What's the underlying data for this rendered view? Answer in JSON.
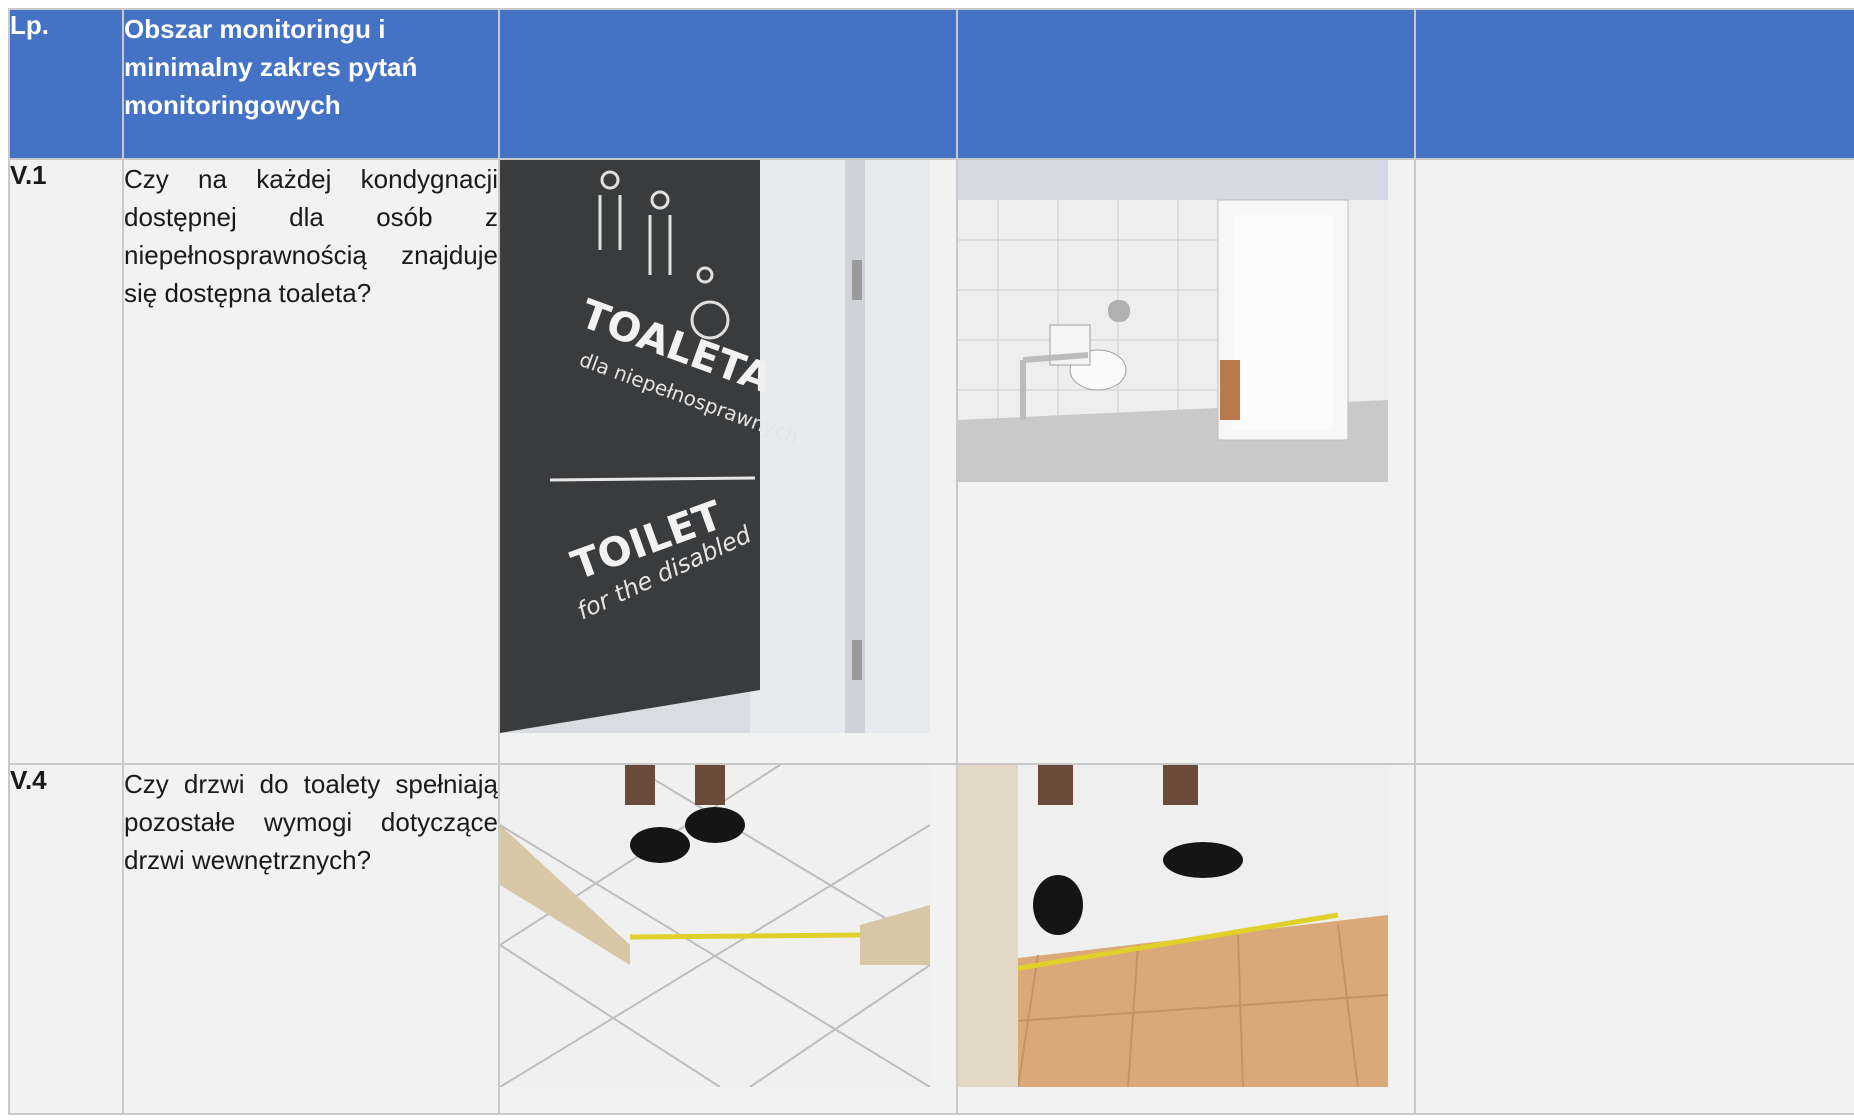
{
  "table": {
    "headers": {
      "lp": "Lp.",
      "area": "Obszar monitoringu i minimalny zakres pytań monitoringowych",
      "col3": "",
      "col4": "",
      "col5": ""
    },
    "rows": [
      {
        "number": "V.1",
        "question": "Czy na każdej kondygnacji dostępnej dla osób z niepełnosprawnością znajduje się dostępna toaleta?",
        "sign_text_pl": "TOALETA",
        "sign_sub_pl": "dla niepełnosprawnych",
        "sign_text_en": "TOILET",
        "sign_sub_en": "for the disabled"
      },
      {
        "number": "V.4",
        "question": "Czy drzwi do toalety spełniają pozostałe wymogi dotyczące drzwi wewnętrznych?"
      }
    ]
  }
}
